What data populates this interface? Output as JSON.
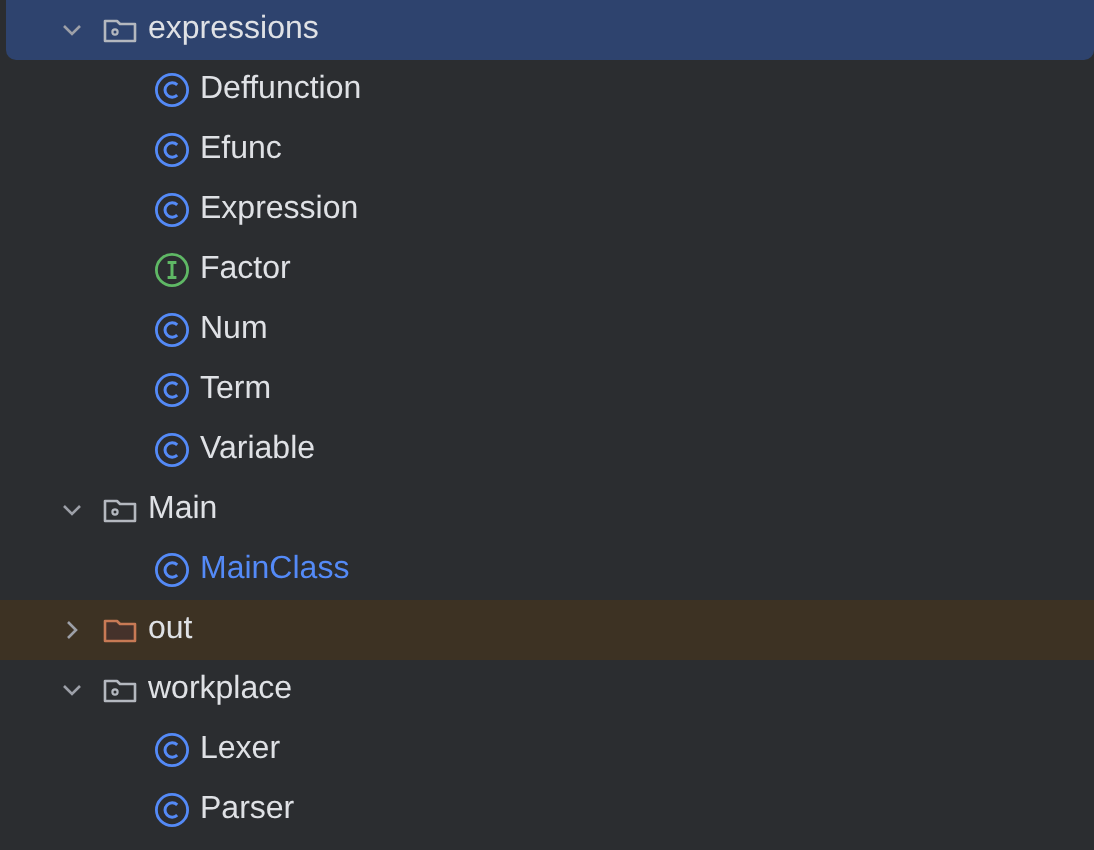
{
  "tree": [
    {
      "kind": "package",
      "label": "expressions",
      "expanded": true,
      "selected": true,
      "children": [
        {
          "kind": "class",
          "label": "Deffunction",
          "modified": false,
          "selected": false
        },
        {
          "kind": "class",
          "label": "Efunc",
          "modified": false,
          "selected": false
        },
        {
          "kind": "class",
          "label": "Expression",
          "modified": false,
          "selected": false
        },
        {
          "kind": "interface",
          "label": "Factor",
          "modified": false,
          "selected": false
        },
        {
          "kind": "class",
          "label": "Num",
          "modified": false,
          "selected": false
        },
        {
          "kind": "class",
          "label": "Term",
          "modified": false,
          "selected": false
        },
        {
          "kind": "class",
          "label": "Variable",
          "modified": false,
          "selected": false
        }
      ]
    },
    {
      "kind": "package",
      "label": "Main",
      "expanded": true,
      "selected": false,
      "children": [
        {
          "kind": "class",
          "label": "MainClass",
          "modified": true,
          "selected": false
        }
      ]
    },
    {
      "kind": "excluded-folder",
      "label": "out",
      "expanded": false,
      "selected": false
    },
    {
      "kind": "package",
      "label": "workplace",
      "expanded": true,
      "selected": false,
      "children": [
        {
          "kind": "class",
          "label": "Lexer",
          "modified": false,
          "selected": false
        },
        {
          "kind": "class",
          "label": "Parser",
          "modified": false,
          "selected": false
        }
      ]
    }
  ]
}
